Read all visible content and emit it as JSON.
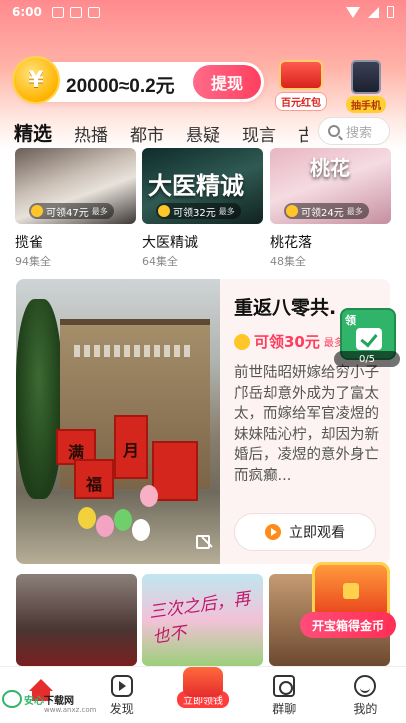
{
  "status_bar": {
    "time": "6:00"
  },
  "coins": {
    "amount": "20000≈0.2元",
    "coin_symbol": "¥",
    "withdraw_label": "提现"
  },
  "promos": [
    {
      "label": "百元红包",
      "icon": "red-envelope-icon"
    },
    {
      "label": "抽手机",
      "icon": "phone-prize-icon"
    }
  ],
  "tabs": [
    "精选",
    "热播",
    "都市",
    "悬疑",
    "现言",
    "古"
  ],
  "active_tab": "精选",
  "search": {
    "placeholder": "搜索"
  },
  "top_dramas": [
    {
      "title": "揽雀",
      "episodes": "94集全",
      "reward": "可领47元",
      "more": "最多"
    },
    {
      "title": "大医精诚",
      "episodes": "64集全",
      "reward": "可领32元",
      "more": "最多",
      "poster_text": "大医精诚"
    },
    {
      "title": "桃花落",
      "episodes": "48集全",
      "reward": "可领24元",
      "more": "最多",
      "poster_text": "桃花"
    }
  ],
  "featured": {
    "title": "重返八零共.",
    "reward": "可领30元",
    "reward_more": "最多",
    "description": "前世陆昭妍嫁给穷小子邝岳却意外成为了富太太，而嫁给军官凌煜的妹妹陆沁柠，却因为新婚后，凌煜的意外身亡而疯癫...",
    "watch_label": "立即观看",
    "gift_chars": [
      "满",
      "月",
      "福"
    ]
  },
  "floating_task": {
    "label": "领",
    "progress": "0/5"
  },
  "bottom_posters": [
    {
      "art": ""
    },
    {
      "art": "三次之后，再也不"
    },
    {
      "art": ""
    }
  ],
  "chest": {
    "label": "开宝箱得金币"
  },
  "bottom_nav": [
    {
      "label": "首页",
      "icon": "home-icon",
      "active": true
    },
    {
      "label": "发现",
      "icon": "discover-icon"
    },
    {
      "label": "立即领钱",
      "icon": "money-bag-icon"
    },
    {
      "label": "群聊",
      "icon": "group-chat-icon"
    },
    {
      "label": "我的",
      "icon": "profile-icon"
    }
  ],
  "watermark": {
    "brand": "安心",
    "brand2": "下载网",
    "url": "www.anxz.com"
  },
  "colors": {
    "accent": "#ff3d5c",
    "coin": "#ffb400",
    "green": "#2fb46a"
  }
}
